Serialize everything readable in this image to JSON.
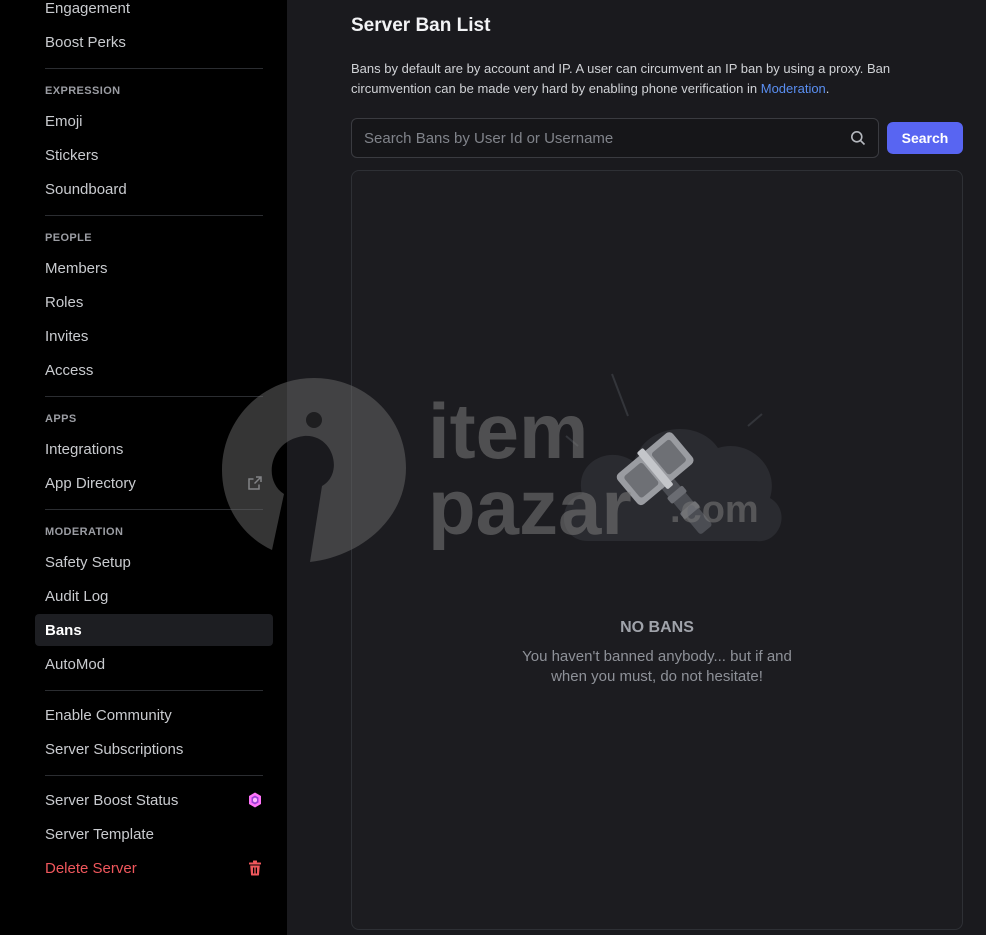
{
  "sidebar": {
    "top_items": [
      {
        "label": "Engagement"
      },
      {
        "label": "Boost Perks"
      }
    ],
    "expression": {
      "heading": "EXPRESSION",
      "items": [
        {
          "label": "Emoji"
        },
        {
          "label": "Stickers"
        },
        {
          "label": "Soundboard"
        }
      ]
    },
    "people": {
      "heading": "PEOPLE",
      "items": [
        {
          "label": "Members"
        },
        {
          "label": "Roles"
        },
        {
          "label": "Invites"
        },
        {
          "label": "Access"
        }
      ]
    },
    "apps": {
      "heading": "APPS",
      "items": [
        {
          "label": "Integrations"
        },
        {
          "label": "App Directory",
          "icon": "external-link-icon"
        }
      ]
    },
    "moderation": {
      "heading": "MODERATION",
      "items": [
        {
          "label": "Safety Setup"
        },
        {
          "label": "Audit Log"
        },
        {
          "label": "Bans",
          "active": true
        },
        {
          "label": "AutoMod"
        }
      ]
    },
    "community": {
      "items": [
        {
          "label": "Enable Community"
        },
        {
          "label": "Server Subscriptions"
        }
      ]
    },
    "server": {
      "items": [
        {
          "label": "Server Boost Status",
          "icon": "boost-gem-icon"
        },
        {
          "label": "Server Template"
        },
        {
          "label": "Delete Server",
          "icon": "trash-icon",
          "danger": true
        }
      ]
    }
  },
  "main": {
    "title": "Server Ban List",
    "description_before": "Bans by default are by account and IP. A user can circumvent an IP ban by using a proxy. Ban circumvention can be made very hard by enabling phone verification in ",
    "description_link": "Moderation",
    "description_after": ".",
    "search": {
      "placeholder": "Search Bans by User Id or Username",
      "value": "",
      "button_label": "Search"
    },
    "empty_state": {
      "title": "NO BANS",
      "subtitle": "You haven't banned anybody... but if and when you must, do not hesitate!"
    }
  },
  "watermark": {
    "line1": "item",
    "line2": "pazar",
    "suffix": ".com"
  },
  "colors": {
    "accent": "#5865f2",
    "link": "#5a8ff2",
    "danger": "#f0575c",
    "boost": "#ff73fa",
    "sidebar_bg": "#000000",
    "main_bg": "#1a1a1e"
  }
}
